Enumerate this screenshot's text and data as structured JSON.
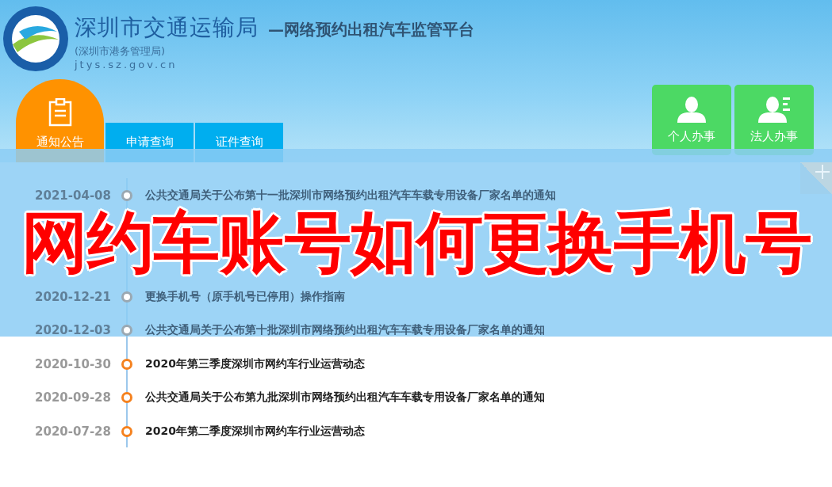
{
  "header": {
    "title": "深圳市交通运输局",
    "subtitle": "—网络预约出租汽车监管平台",
    "note": "(深圳市港务管理局)",
    "url": "jtys.sz.gov.cn"
  },
  "tabs": [
    {
      "label": "通知公告",
      "selected": true
    },
    {
      "label": "申请查询",
      "selected": false
    },
    {
      "label": "证件查询",
      "selected": false
    }
  ],
  "actions": [
    {
      "label": "个人办事",
      "kind": "person"
    },
    {
      "label": "法人办事",
      "kind": "company"
    }
  ],
  "banner": {
    "title": "网约车账号如何更换手机号"
  },
  "notices": [
    {
      "kind": "item",
      "dimmed": true,
      "date": "2021-04-08",
      "title": "公共交通局关于公布第十一批深圳市网络预约出租汽车车载专用设备厂家名单的通知"
    },
    {
      "kind": "covered"
    },
    {
      "kind": "covered"
    },
    {
      "kind": "item",
      "dimmed": true,
      "date": "2020-12-21",
      "title": "更换手机号（原手机号已停用）操作指南"
    },
    {
      "kind": "item",
      "dimmed": true,
      "date": "2020-12-03",
      "title": "公共交通局关于公布第十批深圳市网络预约出租汽车车载专用设备厂家名单的通知"
    },
    {
      "kind": "item",
      "dimmed": false,
      "date": "2020-10-30",
      "title": "2020年第三季度深圳市网约车行业运营动态"
    },
    {
      "kind": "item",
      "dimmed": false,
      "date": "2020-09-28",
      "title": "公共交通局关于公布第九批深圳市网络预约出租汽车车载专用设备厂家名单的通知"
    },
    {
      "kind": "item",
      "dimmed": false,
      "date": "2020-07-28",
      "title": "2020年第二季度深圳市网约车行业运营动态"
    }
  ]
}
